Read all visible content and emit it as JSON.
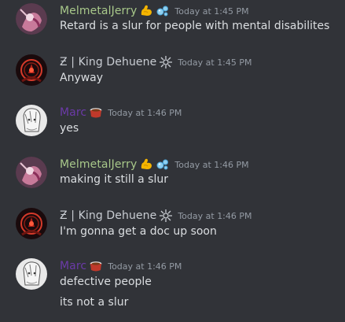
{
  "messages": [
    {
      "user": "MelmetalJerry",
      "badges": [
        "flexed-biceps-icon",
        "bubbles-icon"
      ],
      "timestamp": "Today at 1:45 PM",
      "lines": [
        "Retard is a slur for people with mental disabilites"
      ]
    },
    {
      "user": "Ƶ | King Dehuene",
      "badges": [
        "sunburst-emblem-icon"
      ],
      "timestamp": "Today at 1:45 PM",
      "lines": [
        "Anyway"
      ]
    },
    {
      "user": "Marc",
      "badges": [
        "cup-icon"
      ],
      "timestamp": "Today at 1:46 PM",
      "lines": [
        "yes"
      ]
    },
    {
      "user": "MelmetalJerry",
      "badges": [
        "flexed-biceps-icon",
        "bubbles-icon"
      ],
      "timestamp": "Today at 1:46 PM",
      "lines": [
        "making it still a slur"
      ]
    },
    {
      "user": "Ƶ | King Dehuene",
      "badges": [
        "sunburst-emblem-icon"
      ],
      "timestamp": "Today at 1:46 PM",
      "lines": [
        "I'm gonna get a doc up soon"
      ]
    },
    {
      "user": "Marc",
      "badges": [
        "cup-icon"
      ],
      "timestamp": "Today at 1:46 PM",
      "lines": [
        "defective people",
        "its not a slur"
      ]
    }
  ],
  "colors": {
    "background": "#313338",
    "text": "#dbdee1",
    "timestamp": "#949ba4",
    "melmetal_name": "#a8c88a",
    "king_name": "#c9cdd3",
    "marc_name": "#6b3aa8"
  }
}
